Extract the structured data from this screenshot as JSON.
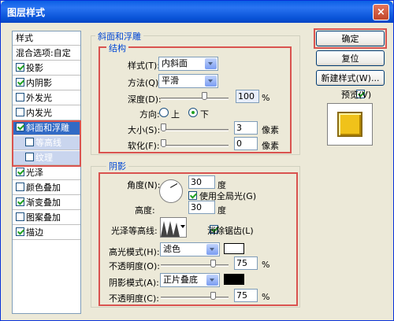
{
  "window": {
    "title": "图层样式",
    "close": "×"
  },
  "left_panel": {
    "items": [
      {
        "label": "样式",
        "checkbox": false,
        "checked": false
      },
      {
        "label": "混合选项:自定",
        "checkbox": false,
        "checked": false
      },
      {
        "label": "投影",
        "checkbox": true,
        "checked": true
      },
      {
        "label": "内阴影",
        "checkbox": true,
        "checked": true
      },
      {
        "label": "外发光",
        "checkbox": true,
        "checked": false
      },
      {
        "label": "内发光",
        "checkbox": true,
        "checked": false
      },
      {
        "label": "斜面和浮雕",
        "checkbox": true,
        "checked": true
      },
      {
        "label": "等高线",
        "checkbox": true,
        "checked": false
      },
      {
        "label": "纹理",
        "checkbox": true,
        "checked": false
      },
      {
        "label": "光泽",
        "checkbox": true,
        "checked": true
      },
      {
        "label": "颜色叠加",
        "checkbox": true,
        "checked": false
      },
      {
        "label": "渐变叠加",
        "checkbox": true,
        "checked": true
      },
      {
        "label": "图案叠加",
        "checkbox": true,
        "checked": false
      },
      {
        "label": "描边",
        "checkbox": true,
        "checked": true
      }
    ]
  },
  "bevel": {
    "group_title": "斜面和浮雕",
    "structure_title": "结构",
    "style_label": "样式(T):",
    "style_value": "内斜面",
    "method_label": "方法(Q):",
    "method_value": "平滑",
    "depth_label": "深度(D):",
    "depth_value": "100",
    "depth_unit": "%",
    "direction_label": "方向:",
    "dir_up": "上",
    "dir_down": "下",
    "size_label": "大小(S):",
    "size_value": "3",
    "size_unit": "像素",
    "soften_label": "软化(F):",
    "soften_value": "0",
    "soften_unit": "像素"
  },
  "shading": {
    "title": "阴影",
    "angle_label": "角度(N):",
    "angle_value": "30",
    "angle_unit": "度",
    "global_light": "使用全局光(G)",
    "altitude_label": "高度:",
    "altitude_value": "30",
    "altitude_unit": "度",
    "gloss_label": "光泽等高线:",
    "anti_alias": "消除锯齿(L)",
    "highlight_mode_label": "高光模式(H):",
    "highlight_mode_value": "滤色",
    "highlight_color": "#ffffff",
    "highlight_opacity_label": "不透明度(O):",
    "highlight_opacity_value": "75",
    "highlight_opacity_unit": "%",
    "shadow_mode_label": "阴影模式(A):",
    "shadow_mode_value": "正片叠底",
    "shadow_color": "#000000",
    "shadow_opacity_label": "不透明度(C):",
    "shadow_opacity_value": "75",
    "shadow_opacity_unit": "%"
  },
  "right": {
    "ok": "确定",
    "reset": "复位",
    "new_style": "新建样式(W)...",
    "preview": "预览(V)",
    "preview_color": "#f0c21a"
  },
  "accent_red": "#d9534f"
}
